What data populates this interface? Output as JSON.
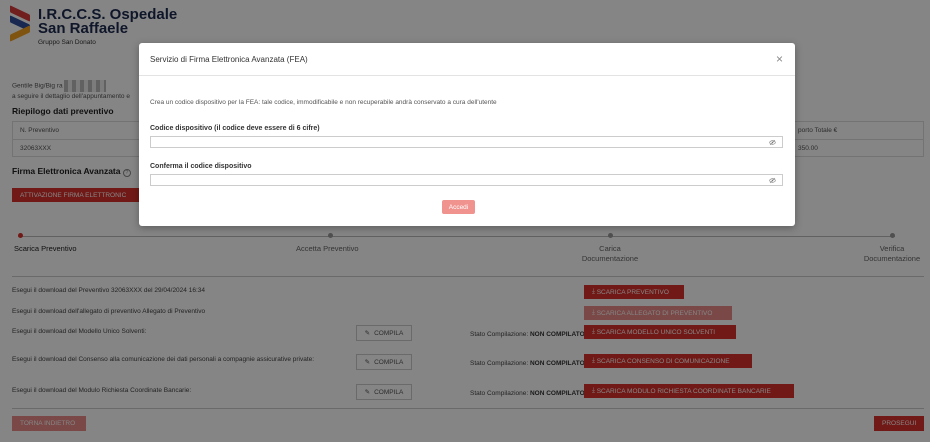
{
  "brand": {
    "name_line1": "I.R.C.C.S. Ospedale",
    "name_line2": "San Raffaele",
    "group": "Gruppo San Donato"
  },
  "page": {
    "greeting_prefix": "Gentile Big/Big ra",
    "greeting_line2": "a seguire il dettaglio dell'appuntamento e",
    "summary_title": "Riepilogo dati preventivo",
    "summary_col1_label": "N. Preventivo",
    "summary_col1_value": "32063XXX",
    "summary_col2_label": "porto Totale €",
    "summary_col2_value": "350.00",
    "fea_title": "Firma Elettronica Avanzata",
    "fea_button": "ATTIVAZIONE FIRMA ELETTRONIC",
    "steps": [
      {
        "label": "Scarica Preventivo",
        "active": true
      },
      {
        "label": "Accetta Preventivo",
        "active": false
      },
      {
        "label": "Carica Documentazione",
        "active": false
      },
      {
        "label": "Verifica Documentazione",
        "active": false
      }
    ],
    "rows": [
      {
        "text": "Esegui il download del Preventivo 32063XXX del 29/04/2024 16:34",
        "action": "SCARICA PREVENTIVO",
        "action_disabled": false,
        "compila": false
      },
      {
        "text": "Esegui il download dell'allegato di preventivo Allegato di Preventivo",
        "action": "SCARICA ALLEGATO DI PREVENTIVO",
        "action_disabled": true,
        "compila": false
      },
      {
        "text": "Esegui il download del Modello Unico Solventi:",
        "action": "SCARICA MODELLO UNICO SOLVENTI",
        "action_disabled": false,
        "compila": true,
        "stato_prefix": "Stato Compilazione: ",
        "stato_value": "NON COMPILATO"
      },
      {
        "text": "Esegui il download del Consenso alla comunicazione dei dati personali a compagnie assicurative private:",
        "action": "SCARICA CONSENSO DI COMUNICAZIONE",
        "action_disabled": false,
        "compila": true,
        "stato_prefix": "Stato Compilazione: ",
        "stato_value": "NON COMPILATO"
      },
      {
        "text": "Esegui il download del Modulo Richiesta Coordinate Bancarie:",
        "action": "SCARICA MODULO RICHIESTA COORDINATE BANCARIE",
        "action_disabled": false,
        "compila": true,
        "stato_prefix": "Stato Compilazione: ",
        "stato_value": "NON COMPILATO"
      }
    ],
    "compila_label": "COMPILA",
    "back_button": "TORNA INDIETRO",
    "next_button": "PROSEGUI"
  },
  "modal": {
    "title": "Servizio di Firma Elettronica Avanzata (FEA)",
    "description": "Crea un codice dispositivo per la FEA: tale codice, immodificabile e non recuperabile andrà conservato a cura dell'utente",
    "code_label": "Codice dispositivo (il codice deve essere di 6 cifre)",
    "confirm_label": "Conferma il codice dispositivo",
    "submit_label": "Accedi"
  },
  "colors": {
    "accent": "#d9302b",
    "brand_navy": "#1d2b4f"
  }
}
